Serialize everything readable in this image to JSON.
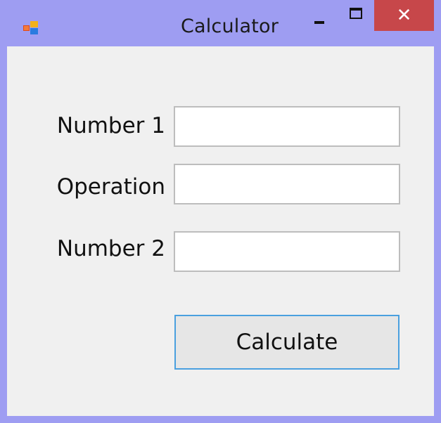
{
  "window": {
    "title": "Calculator",
    "app_icon": "app-form-icon",
    "controls": {
      "minimize_icon": "minimize-icon",
      "maximize_icon": "maximize-icon",
      "close_glyph": "✕",
      "close_color": "#c7474a"
    },
    "frame_color": "#9e9df2"
  },
  "form": {
    "number1": {
      "label": "Number 1",
      "value": ""
    },
    "operation": {
      "label": "Operation",
      "value": ""
    },
    "number2": {
      "label": "Number 2",
      "value": ""
    },
    "calculate_label": "Calculate",
    "button_border_color": "#4aa0df"
  }
}
